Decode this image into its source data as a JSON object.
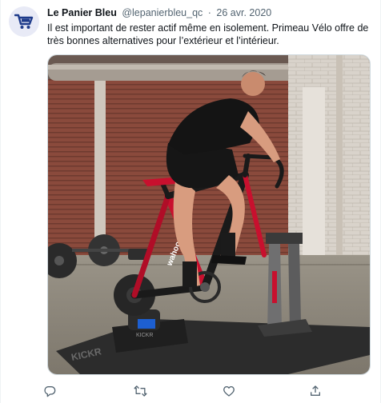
{
  "tweet": {
    "author_name": "Le Panier Bleu",
    "author_handle": "@lepanierbleu_qc",
    "separator": "·",
    "date": "26 avr. 2020",
    "text_lines": [
      "Il est important de rester actif même en isolement. Primeau Vélo offre de",
      "très bonnes alternatives pour l’extérieur et l’intérieur."
    ],
    "photo_lettering": {
      "trainer_brand": "wahoo",
      "trainer_model": "KICKR",
      "mat_brand": "KICKR"
    }
  },
  "icons": {
    "avatar": "shopping-cart-icon",
    "reply": "reply-icon",
    "retweet": "retweet-icon",
    "like": "heart-icon",
    "share": "share-icon"
  },
  "colors": {
    "brand_blue": "#1d3a8a",
    "action_gray": "#536471",
    "bike_red": "#c8102e"
  }
}
